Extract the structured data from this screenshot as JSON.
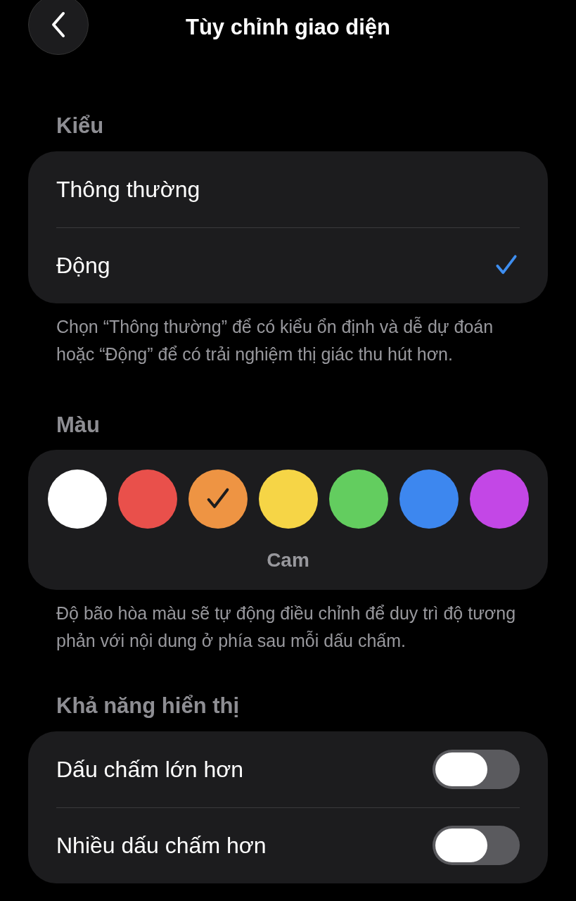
{
  "header": {
    "title": "Tùy chỉnh giao diện"
  },
  "style_section": {
    "heading": "Kiểu",
    "options": [
      {
        "label": "Thông thường",
        "selected": false
      },
      {
        "label": "Động",
        "selected": true
      }
    ],
    "note": "Chọn “Thông thường” để có kiểu ổn định và dễ dự đoán hoặc “Động” để có trải nghiệm thị giác thu hút hơn."
  },
  "color_section": {
    "heading": "Màu",
    "swatches": [
      {
        "color": "#ffffff",
        "selected": false
      },
      {
        "color": "#e9504b",
        "selected": false
      },
      {
        "color": "#ee9443",
        "selected": true
      },
      {
        "color": "#f6d546",
        "selected": false
      },
      {
        "color": "#63cd5f",
        "selected": false
      },
      {
        "color": "#3d87ef",
        "selected": false
      },
      {
        "color": "#c347e6",
        "selected": false
      }
    ],
    "selected_name": "Cam",
    "note": "Độ bão hòa màu sẽ tự động điều chỉnh để duy trì độ tương phản với nội dung ở phía sau mỗi dấu chấm."
  },
  "visibility_section": {
    "heading": "Khả năng hiển thị",
    "toggles": [
      {
        "label": "Dấu chấm lớn hơn",
        "on": false
      },
      {
        "label": "Nhiều dấu chấm hơn",
        "on": false
      }
    ]
  }
}
